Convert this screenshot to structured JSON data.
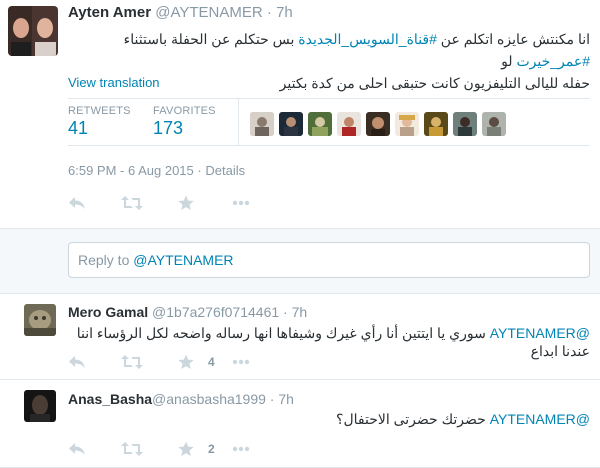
{
  "colors": {
    "link": "#0084b4",
    "text": "#292f33",
    "muted": "#8899a6",
    "border": "#e1e8ed",
    "reply_bg": "#f5f8fa",
    "icon": "#ccd6dd"
  },
  "main_tweet": {
    "fullname": "Ayten Amer",
    "handle": "@AYTENAMER",
    "separator": "·",
    "time": "7h",
    "text_line1_a": "انا مكنتش عايزه اتكلم عن ",
    "text_line1_link": "#قناة_السويس_الجديدة",
    "text_line1_b": " بس حتكلم عن الحفلة باستثناء ",
    "text_line1_link2": "#عمر_خيرت",
    "text_line1_c": " لو",
    "text_line2": "حفله لليالى التليفزيون كانت حتبقى احلى من كدة بكتير",
    "view_translation": "View translation",
    "retweets_label": "RETWEETS",
    "retweets_value": "41",
    "favorites_label": "FAVORITES",
    "favorites_value": "173",
    "timestamp": "6:59 PM - 6 Aug 2015",
    "meta_separator": "·",
    "details": "Details",
    "action_icons": [
      "reply-icon",
      "retweet-icon",
      "favorite-icon",
      "more-icon"
    ]
  },
  "reply_box": {
    "prefix": "Reply to ",
    "mention": "@AYTENAMER"
  },
  "replies": [
    {
      "fullname": "Mero Gamal",
      "handle": "@1b7a276f0714461",
      "separator": "·",
      "time": "7h",
      "mention": "@AYTENAMER",
      "text": " سوري يا ايتتين أنا رأي غيرك وشيفاها انها رساله واضحه لكل الرؤساء اننا عندنا ابداع",
      "favorite_count": "4"
    },
    {
      "fullname": "Anas_Basha",
      "handle": "@anasbasha1999",
      "separator": "·",
      "time": "7h",
      "mention": "@AYTENAMER",
      "text": " حضرتك حضرتى الاحتفال؟",
      "favorite_count": "2"
    }
  ]
}
